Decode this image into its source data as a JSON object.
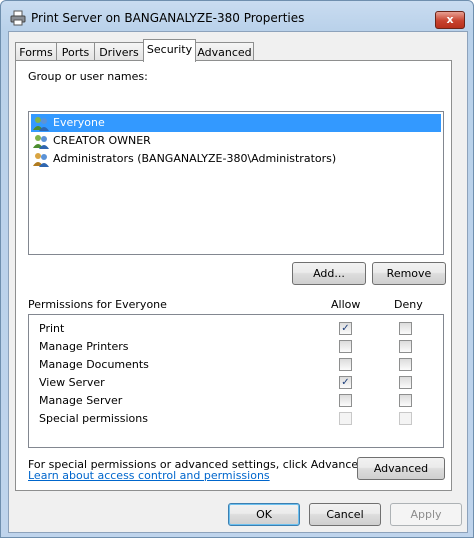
{
  "window": {
    "title": "Print Server on BANGANALYZE-380 Properties",
    "close_label": "x"
  },
  "tabs": [
    {
      "label": "Forms",
      "active": false
    },
    {
      "label": "Ports",
      "active": false
    },
    {
      "label": "Drivers",
      "active": false
    },
    {
      "label": "Security",
      "active": true
    },
    {
      "label": "Advanced",
      "active": false
    }
  ],
  "security": {
    "group_label": "Group or user names:",
    "users": [
      {
        "name": "Everyone",
        "selected": true,
        "icon": "users-group-icon"
      },
      {
        "name": "CREATOR OWNER",
        "selected": false,
        "icon": "users-group-icon"
      },
      {
        "name": "Administrators (BANGANALYZE-380\\Administrators)",
        "selected": false,
        "icon": "users-group-icon"
      }
    ],
    "add_button": "Add...",
    "remove_button": "Remove",
    "permissions_label": "Permissions for Everyone",
    "allow_header": "Allow",
    "deny_header": "Deny",
    "permissions": [
      {
        "name": "Print",
        "allow": true,
        "deny": false,
        "enabled": true
      },
      {
        "name": "Manage Printers",
        "allow": false,
        "deny": false,
        "enabled": true
      },
      {
        "name": "Manage Documents",
        "allow": false,
        "deny": false,
        "enabled": true
      },
      {
        "name": "View Server",
        "allow": true,
        "deny": false,
        "enabled": true
      },
      {
        "name": "Manage Server",
        "allow": false,
        "deny": false,
        "enabled": true
      },
      {
        "name": "Special permissions",
        "allow": false,
        "deny": false,
        "enabled": false
      }
    ],
    "special_text": "For special permissions or advanced settings, click Advanced.",
    "advanced_button": "Advanced",
    "learn_link": "Learn about access control and permissions"
  },
  "footer": {
    "ok": "OK",
    "cancel": "Cancel",
    "apply": "Apply"
  },
  "colors": {
    "selection": "#3399ff",
    "link": "#0066cc"
  }
}
